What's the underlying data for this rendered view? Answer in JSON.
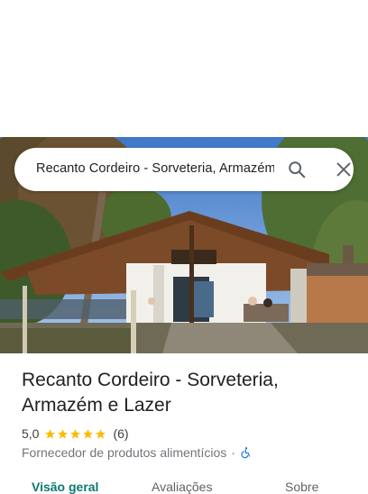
{
  "search": {
    "query": "Recanto Cordeiro - Sorveteria, Armazém e Lazer"
  },
  "icons": {
    "search": "search-icon",
    "close": "close-icon",
    "accessibility": "wheelchair-icon",
    "star": "star-icon"
  },
  "place": {
    "title": "Recanto Cordeiro - Sorveteria, Armazém e Lazer",
    "rating": "5,0",
    "stars": 5,
    "review_count": "(6)",
    "category": "Fornecedor de produtos alimentícios",
    "separator": "·"
  },
  "tabs": [
    {
      "label": "Visão geral",
      "active": true
    },
    {
      "label": "Avaliações",
      "active": false
    },
    {
      "label": "Sobre",
      "active": false
    }
  ],
  "colors": {
    "star": "#fbbc04",
    "active_tab": "#0b7a6e",
    "accessibility": "#1a73e8"
  }
}
